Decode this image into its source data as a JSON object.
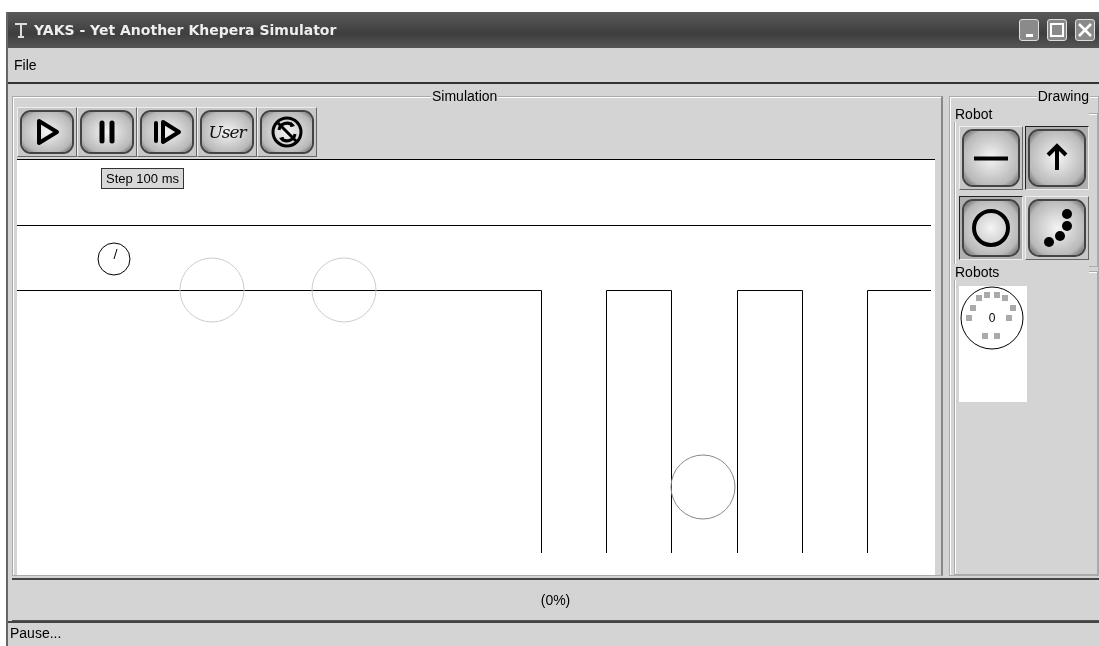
{
  "window": {
    "title": "YAKS - Yet Another Khepera Simulator"
  },
  "menu": [
    "File"
  ],
  "simulation": {
    "title": "Simulation",
    "toolbar": [
      {
        "kind": "play",
        "selected": false
      },
      {
        "kind": "pause",
        "selected": false
      },
      {
        "kind": "step",
        "selected": false
      },
      {
        "kind": "user",
        "label": "User",
        "selected": false
      },
      {
        "kind": "reset",
        "selected": false
      }
    ],
    "tooltip": "Step 100 ms"
  },
  "drawing": {
    "title": "Drawing",
    "robot_group": "Robot",
    "tools": [
      {
        "kind": "line",
        "selected": false
      },
      {
        "kind": "arrow",
        "selected": true
      },
      {
        "kind": "circle",
        "selected": true
      },
      {
        "kind": "dots",
        "selected": false
      }
    ],
    "robots_group": "Robots",
    "robots": [
      {
        "label": "0"
      }
    ]
  },
  "progress": {
    "text": "(0%)"
  },
  "status_bar": "Pause..."
}
